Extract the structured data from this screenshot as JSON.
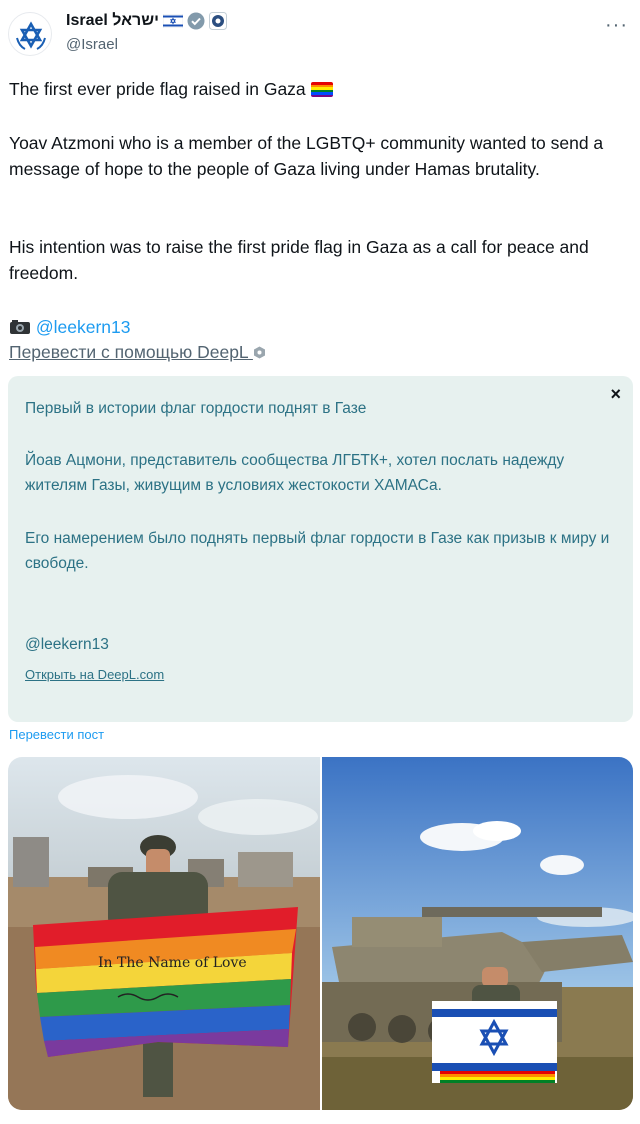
{
  "author": {
    "name": "Israel ישראל",
    "handle": "@Israel",
    "flag_icon": "israel-flag-icon",
    "verified_icon": "verified-badge-icon",
    "affiliation_icon": "government-affiliation-icon"
  },
  "tweet": {
    "line1": "The first ever pride flag raised in Gaza",
    "para2": "Yoav Atzmoni who is a member of the LGBTQ+ community wanted to send a message of hope to the people of Gaza living under Hamas brutality.",
    "para3": "His intention was to raise the first pride flag in Gaza as a call for peace and freedom.",
    "credit": "@leekern13"
  },
  "translate_deepl": "Перевести с помощью DeepL",
  "translation": {
    "line1": "Первый в истории флаг гордости поднят в Газе",
    "para2": "Йоав Ацмони, представитель сообщества ЛГБТК+, хотел послать надежду жителям Газы, живущим в условиях жестокости ХАМАСа.",
    "para3": "Его намерением было поднять первый флаг гордости в Газе как призыв к миру и свободе.",
    "credit": "@leekern13",
    "open_link": "Открыть на DeepL.com",
    "close": "×"
  },
  "translate_post": "Перевести пост",
  "photos": {
    "left_flag_text": "In The Name of Love"
  },
  "colors": {
    "link": "#1d9bf0",
    "translation_bg": "#e7f1ef",
    "translation_text": "#2c7285",
    "secondary": "#536471"
  }
}
